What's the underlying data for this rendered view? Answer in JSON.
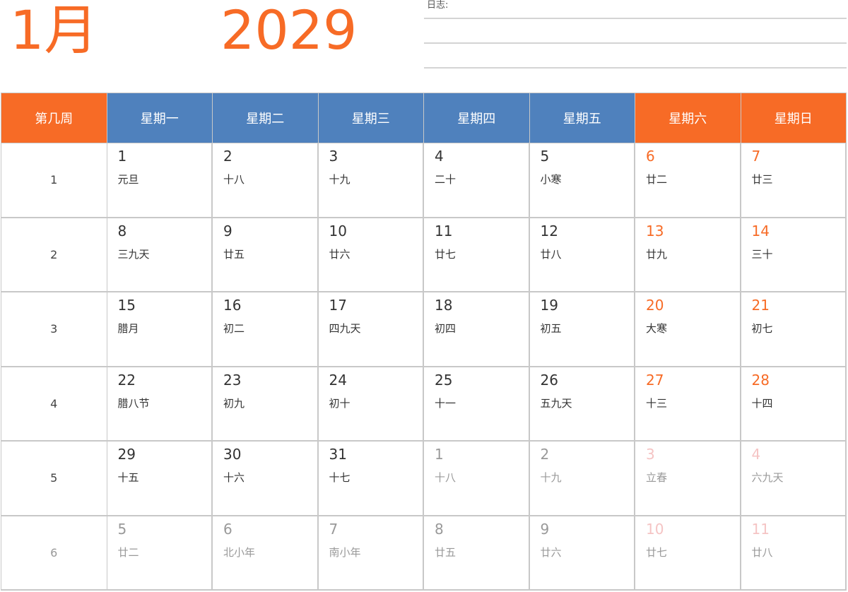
{
  "header": {
    "month": "1月",
    "year": "2029",
    "notes_label": "日志:"
  },
  "colors": {
    "accent_orange": "#f76b26",
    "weekday_blue": "#4f81bd",
    "text_dark": "#333333",
    "text_faded": "#999999",
    "weekend_faded": "#f5c4c4"
  },
  "calendar": {
    "week_header": "第几周",
    "days": [
      "星期一",
      "星期二",
      "星期三",
      "星期四",
      "星期五",
      "星期六",
      "星期日"
    ],
    "weeks": [
      {
        "num": "1",
        "faded": false,
        "days": [
          {
            "d": "1",
            "l": "元旦",
            "cur": true
          },
          {
            "d": "2",
            "l": "十八",
            "cur": true
          },
          {
            "d": "3",
            "l": "十九",
            "cur": true
          },
          {
            "d": "4",
            "l": "二十",
            "cur": true
          },
          {
            "d": "5",
            "l": "小寒",
            "cur": true
          },
          {
            "d": "6",
            "l": "廿二",
            "cur": true
          },
          {
            "d": "7",
            "l": "廿三",
            "cur": true
          }
        ]
      },
      {
        "num": "2",
        "faded": false,
        "days": [
          {
            "d": "8",
            "l": "三九天",
            "cur": true
          },
          {
            "d": "9",
            "l": "廿五",
            "cur": true
          },
          {
            "d": "10",
            "l": "廿六",
            "cur": true
          },
          {
            "d": "11",
            "l": "廿七",
            "cur": true
          },
          {
            "d": "12",
            "l": "廿八",
            "cur": true
          },
          {
            "d": "13",
            "l": "廿九",
            "cur": true
          },
          {
            "d": "14",
            "l": "三十",
            "cur": true
          }
        ]
      },
      {
        "num": "3",
        "faded": false,
        "days": [
          {
            "d": "15",
            "l": "腊月",
            "cur": true
          },
          {
            "d": "16",
            "l": "初二",
            "cur": true
          },
          {
            "d": "17",
            "l": "四九天",
            "cur": true
          },
          {
            "d": "18",
            "l": "初四",
            "cur": true
          },
          {
            "d": "19",
            "l": "初五",
            "cur": true
          },
          {
            "d": "20",
            "l": "大寒",
            "cur": true
          },
          {
            "d": "21",
            "l": "初七",
            "cur": true
          }
        ]
      },
      {
        "num": "4",
        "faded": false,
        "days": [
          {
            "d": "22",
            "l": "腊八节",
            "cur": true
          },
          {
            "d": "23",
            "l": "初九",
            "cur": true
          },
          {
            "d": "24",
            "l": "初十",
            "cur": true
          },
          {
            "d": "25",
            "l": "十一",
            "cur": true
          },
          {
            "d": "26",
            "l": "五九天",
            "cur": true
          },
          {
            "d": "27",
            "l": "十三",
            "cur": true
          },
          {
            "d": "28",
            "l": "十四",
            "cur": true
          }
        ]
      },
      {
        "num": "5",
        "faded": false,
        "days": [
          {
            "d": "29",
            "l": "十五",
            "cur": true
          },
          {
            "d": "30",
            "l": "十六",
            "cur": true
          },
          {
            "d": "31",
            "l": "十七",
            "cur": true
          },
          {
            "d": "1",
            "l": "十八",
            "cur": false
          },
          {
            "d": "2",
            "l": "十九",
            "cur": false
          },
          {
            "d": "3",
            "l": "立春",
            "cur": false
          },
          {
            "d": "4",
            "l": "六九天",
            "cur": false
          }
        ]
      },
      {
        "num": "6",
        "faded": true,
        "days": [
          {
            "d": "5",
            "l": "廿二",
            "cur": false
          },
          {
            "d": "6",
            "l": "北小年",
            "cur": false
          },
          {
            "d": "7",
            "l": "南小年",
            "cur": false
          },
          {
            "d": "8",
            "l": "廿五",
            "cur": false
          },
          {
            "d": "9",
            "l": "廿六",
            "cur": false
          },
          {
            "d": "10",
            "l": "廿七",
            "cur": false
          },
          {
            "d": "11",
            "l": "廿八",
            "cur": false
          }
        ]
      }
    ]
  }
}
